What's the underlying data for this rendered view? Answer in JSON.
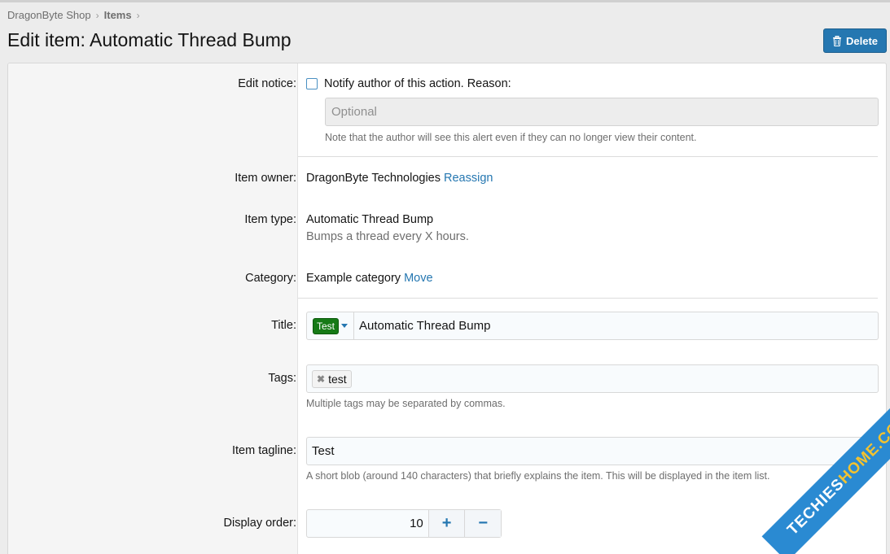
{
  "breadcrumb": {
    "shop": "DragonByte Shop",
    "items": "Items",
    "sep": "›"
  },
  "page_title": "Edit item: Automatic Thread Bump",
  "delete_button": "Delete",
  "edit_notice": {
    "label": "Edit notice:",
    "checkbox_label": "Notify author of this action. Reason:",
    "checked": false,
    "placeholder": "Optional",
    "hint": "Note that the author will see this alert even if they can no longer view their content."
  },
  "item_owner": {
    "label": "Item owner:",
    "value": "DragonByte Technologies",
    "link": "Reassign"
  },
  "item_type": {
    "label": "Item type:",
    "value": "Automatic Thread Bump",
    "description": "Bumps a thread every X hours."
  },
  "category": {
    "label": "Category:",
    "value": "Example category",
    "link": "Move"
  },
  "title": {
    "label": "Title:",
    "prefix": "Test",
    "value": "Automatic Thread Bump"
  },
  "tags": {
    "label": "Tags:",
    "items": [
      "test"
    ],
    "hint": "Multiple tags may be separated by commas."
  },
  "tagline": {
    "label": "Item tagline:",
    "value": "Test",
    "hint": "A short blob (around 140 characters) that briefly explains the item. This will be displayed in the item list."
  },
  "display_order": {
    "label": "Display order:",
    "value": "10",
    "plus": "+",
    "minus": "−"
  },
  "watermark": {
    "part1": "TECHIES",
    "part2": "HOME.COM"
  },
  "colors": {
    "accent": "#2577b1",
    "prefix_tag": "#167a16"
  }
}
